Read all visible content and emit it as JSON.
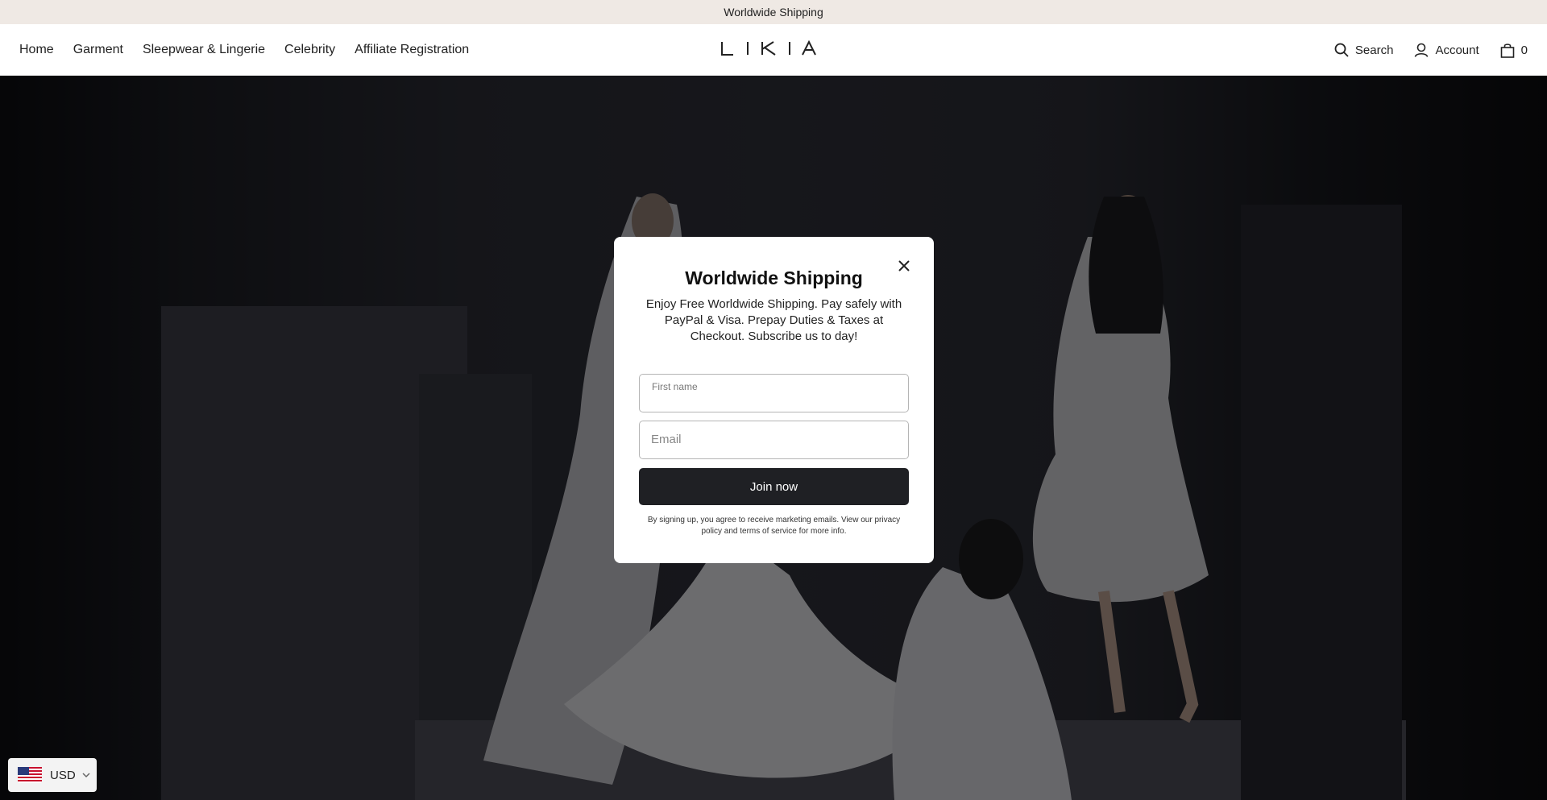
{
  "announcement": {
    "text": "Worldwide Shipping"
  },
  "nav": {
    "items": [
      {
        "label": "Home"
      },
      {
        "label": "Garment"
      },
      {
        "label": "Sleepwear & Lingerie"
      },
      {
        "label": "Celebrity"
      },
      {
        "label": "Affiliate Registration"
      }
    ]
  },
  "brand": {
    "logo_text": "LIKIA"
  },
  "header_actions": {
    "search_label": "Search",
    "account_label": "Account",
    "cart_count": "0"
  },
  "modal": {
    "title": "Worldwide Shipping",
    "description": "Enjoy Free Worldwide Shipping. Pay safely with PayPal & Visa. Prepay Duties & Taxes at Checkout. Subscribe us to day!",
    "first_name_label": "First name",
    "first_name_value": "",
    "email_placeholder": "Email",
    "email_value": "",
    "button_label": "Join now",
    "legal": "By signing up, you agree to receive marketing emails. View our privacy policy and terms of service for more info."
  },
  "currency": {
    "code": "USD"
  },
  "colors": {
    "button_bg": "#1f2024",
    "announcement_bg": "#efe9e4"
  },
  "icons": [
    "search-icon",
    "account-icon",
    "cart-icon",
    "close-icon",
    "us-flag-icon",
    "chevron-down-icon"
  ]
}
